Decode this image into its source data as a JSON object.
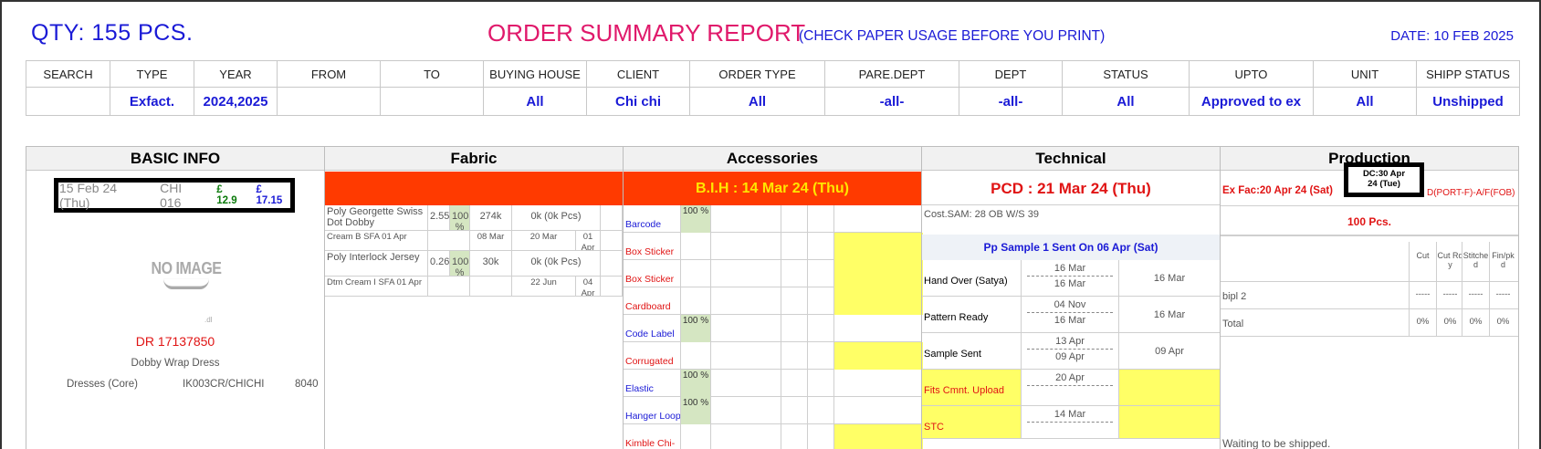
{
  "header": {
    "qty": "QTY: 155 PCS.",
    "title": "ORDER SUMMARY REPORT",
    "subtitle": "(CHECK PAPER USAGE BEFORE YOU PRINT)",
    "date": "DATE: 10 FEB 2025"
  },
  "filters": {
    "headers": [
      "SEARCH",
      "TYPE",
      "YEAR",
      "FROM",
      "TO",
      "BUYING HOUSE",
      "CLIENT",
      "ORDER TYPE",
      "PARE.DEPT",
      "DEPT",
      "STATUS",
      "UPTO",
      "UNIT",
      "SHIPP STATUS"
    ],
    "values": [
      "",
      "Exfact.",
      "2024,2025",
      "",
      "",
      "All",
      "Chi chi",
      "All",
      "-all-",
      "-all-",
      "All",
      "Approved to ex",
      "All",
      "Unshipped"
    ]
  },
  "sections": {
    "basic": "BASIC INFO",
    "fabric": "Fabric",
    "accessories": "Accessories",
    "technical": "Technical",
    "production": "Production"
  },
  "basic": {
    "date": "15 Feb 24 (Thu)",
    "code": "CHI 016",
    "price1": "£ 12.9",
    "price2": "£ 17.15",
    "no_image": "NO IMAGE",
    "mark": ".dl",
    "dr": "DR 17137850",
    "style": "Dobby Wrap Dress",
    "category": "Dresses (Core)",
    "ref": "IK003CR/CHICHI",
    "num": "8040"
  },
  "fabric": {
    "rows": [
      {
        "name": "Poly Georgette Swiss Dot Dobby",
        "cons": "2.55",
        "pct": "100 %",
        "qty": "274k",
        "recv": "0k (0k Pcs)"
      },
      {
        "name": "Poly Interlock Jersey",
        "cons": "0.26",
        "pct": "100 %",
        "qty": "30k",
        "recv": "0k (0k Pcs)"
      }
    ],
    "subrows": [
      {
        "name": "Cream B SFA 01 Apr",
        "d1": "08 Mar",
        "d2": "20 Mar",
        "d3": "01 Apr"
      },
      {
        "name": "Dtm Cream I SFA 01 Apr",
        "d1": "",
        "d2": "22 Jun",
        "d3": "04 Apr"
      }
    ]
  },
  "accessories": {
    "bih": "B.I.H : 14 Mar 24 (Thu)",
    "items": [
      {
        "name": "Barcode",
        "pct": "100 %",
        "color": "blue",
        "flag": false
      },
      {
        "name": "Box Sticker",
        "pct": "",
        "color": "red",
        "flag": true
      },
      {
        "name": "Box Sticker",
        "pct": "",
        "color": "red",
        "flag": true
      },
      {
        "name": "Cardboard",
        "pct": "",
        "color": "red",
        "flag": true
      },
      {
        "name": "Code Label",
        "pct": "100 %",
        "color": "blue",
        "flag": false
      },
      {
        "name": "Corrugated",
        "pct": "",
        "color": "red",
        "flag": true
      },
      {
        "name": "Elastic",
        "pct": "100 %",
        "color": "blue",
        "flag": false
      },
      {
        "name": "Hanger Loop",
        "pct": "100 %",
        "color": "blue",
        "flag": false
      },
      {
        "name": "Kimble Chi-",
        "pct": "",
        "color": "red",
        "flag": true
      }
    ]
  },
  "technical": {
    "pcd": "PCD : 21 Mar 24 (Thu)",
    "cost": "Cost.SAM:  28   OB W/S 39",
    "pp": "Pp Sample 1 Sent On 06 Apr (Sat)",
    "rows": [
      {
        "label": "Hand Over (Satya)",
        "a": "16 Mar",
        "b": "16 Mar",
        "right": "16 Mar",
        "warn": false
      },
      {
        "label": "Pattern Ready",
        "a": "04 Nov",
        "b": "16 Mar",
        "right": "16 Mar",
        "warn": false
      },
      {
        "label": "Sample Sent",
        "a": "13 Apr",
        "b": "09 Apr",
        "right": "09 Apr",
        "warn": false
      },
      {
        "label": "Fits Cmnt. Upload",
        "a": "20 Apr",
        "b": "",
        "right": "",
        "warn": true
      },
      {
        "label": "STC",
        "a": "14 Mar",
        "b": "",
        "right": "",
        "warn": true
      }
    ]
  },
  "production": {
    "exfac": "Ex Fac:20 Apr 24 (Sat)",
    "dc_line1": "DC:30 Apr",
    "dc_line2": "24 (Tue)",
    "port": "D(PORT-F)-A/F(FOB)",
    "pcs": "100 Pcs.",
    "cols": [
      "Cut",
      "Cut Rdy",
      "Stitched",
      "Fin/pkd"
    ],
    "rows": [
      {
        "name": "bipl 2",
        "vals": [
          "-----",
          "-----",
          "-----",
          "-----"
        ]
      },
      {
        "name": "Total",
        "vals": [
          "0%",
          "0%",
          "0%",
          "0%"
        ]
      }
    ],
    "waiting": "Waiting to be shipped."
  }
}
